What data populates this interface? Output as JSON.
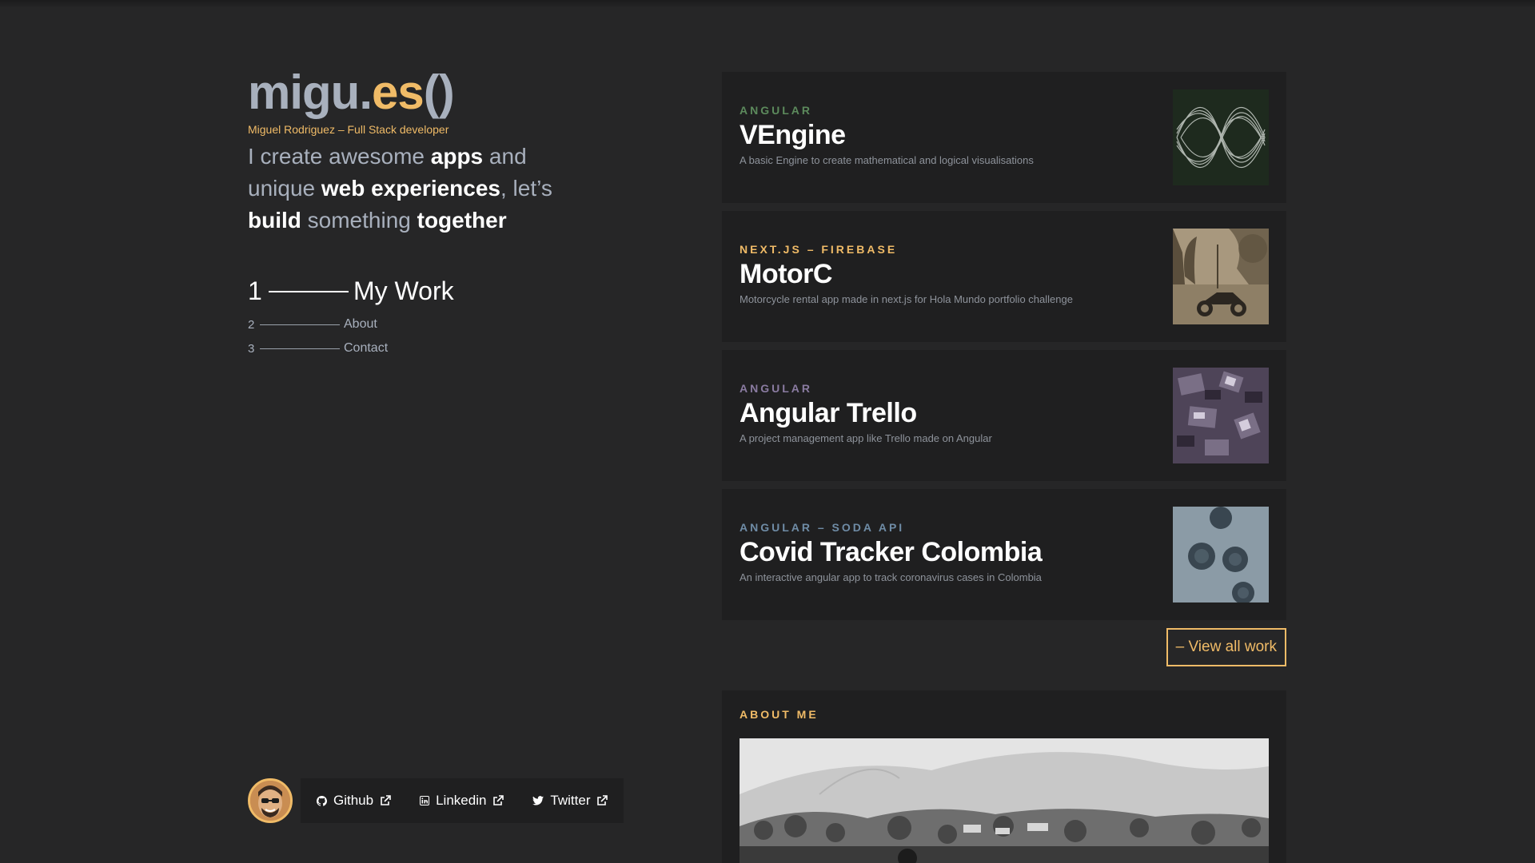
{
  "brand": {
    "logo_main": "migu.",
    "logo_accent": "es",
    "logo_tail": "()",
    "subtitle": "Miguel Rodriguez – Full Stack developer"
  },
  "tagline": {
    "p1": "I create awesome ",
    "b1": "apps",
    "p2": " and unique ",
    "b2": "web experiences",
    "p3": ", let’s ",
    "b3": "build",
    "p4": " something ",
    "b4": "together"
  },
  "nav": [
    {
      "num": "1",
      "label": "My Work"
    },
    {
      "num": "2",
      "label": "About"
    },
    {
      "num": "3",
      "label": "Contact"
    }
  ],
  "social": [
    {
      "label": "Github",
      "icon": "github-icon"
    },
    {
      "label": "Linkedin",
      "icon": "linkedin-icon"
    },
    {
      "label": "Twitter",
      "icon": "twitter-icon"
    }
  ],
  "projects": [
    {
      "tag": "ANGULAR",
      "tag_color": "#5c8a5c",
      "title": "VEngine",
      "desc": "A basic Engine to create mathematical and logical visualisations"
    },
    {
      "tag": "NEXT.JS – FIREBASE",
      "tag_color": "#f0bb67",
      "title": "MotorC",
      "desc": "Motorcycle rental app made in next.js for Hola Mundo portfolio challenge"
    },
    {
      "tag": "ANGULAR",
      "tag_color": "#8a7ba1",
      "title": "Angular Trello",
      "desc": "A project management app like Trello made on Angular"
    },
    {
      "tag": "ANGULAR – SODA API",
      "tag_color": "#6f8ca6",
      "title": "Covid Tracker Colombia",
      "desc": "An interactive angular app to track coronavirus cases in Colombia"
    }
  ],
  "view_all": "– View all work",
  "about": {
    "heading": "ABOUT ME"
  }
}
